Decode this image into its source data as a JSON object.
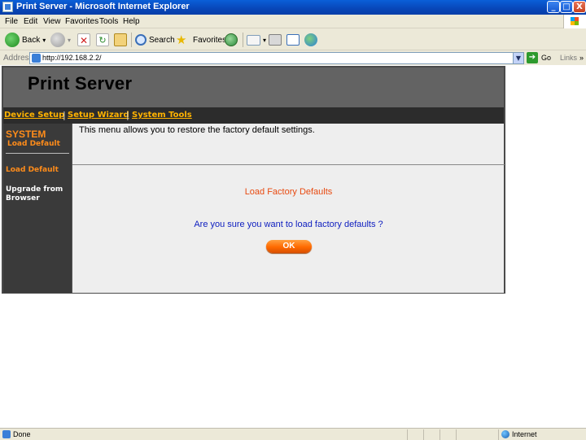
{
  "window": {
    "title": "Print Server - Microsoft Internet Explorer",
    "minimize": "_",
    "maximize": "□",
    "close": "X"
  },
  "menu": [
    "File",
    "Edit",
    "View",
    "Favorites",
    "Tools",
    "Help"
  ],
  "toolbar": {
    "back": "Back",
    "search": "Search",
    "favorites": "Favorites"
  },
  "address": {
    "label": "Address",
    "url": "http://192.168.2.2/",
    "go": "Go",
    "links": "Links"
  },
  "page": {
    "title": "Print Server",
    "nav": [
      "Device Setup",
      "Setup Wizard",
      "System Tools"
    ],
    "sidebar": {
      "section": "SYSTEM",
      "section_sub": "Load Default",
      "items": [
        "Load Default",
        "Upgrade from Browser"
      ]
    },
    "content": {
      "description": "This menu allows you to restore the factory default settings.",
      "heading": "Load Factory Defaults",
      "question": "Are you sure you want to load factory defaults ?",
      "ok_label": "OK"
    }
  },
  "status": {
    "text": "Done",
    "zone": "Internet"
  },
  "colors": {
    "nav_link": "#ffb300",
    "sidebar_accent": "#ff8c1a",
    "heading": "#e84a10",
    "question": "#1020c0"
  }
}
